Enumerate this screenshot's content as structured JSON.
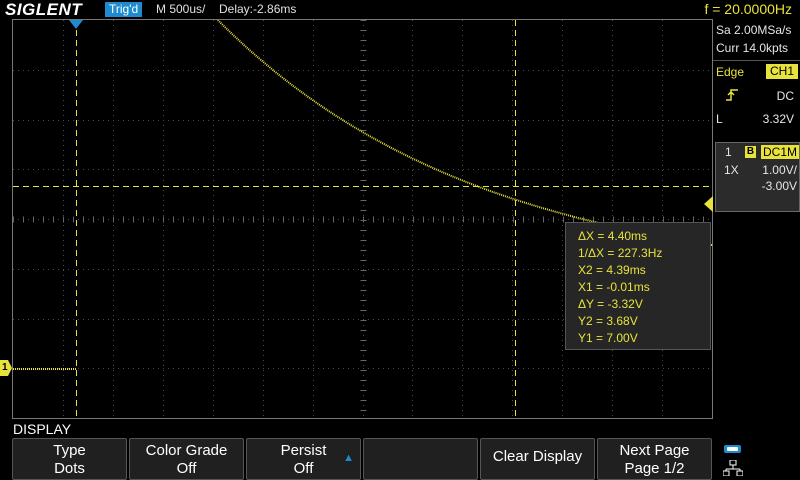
{
  "topbar": {
    "brand": "SIGLENT",
    "trigger_status": "Trig'd",
    "timebase": "M 500us/",
    "delay": "Delay:-2.86ms",
    "frequency": "f = 20.0000Hz"
  },
  "acquisition": {
    "sample_rate": "Sa 2.00MSa/s",
    "memory_depth": "Curr 14.0kpts"
  },
  "trigger": {
    "type": "Edge",
    "source": "CH1",
    "coupling": "DC",
    "level_label": "L",
    "level": "3.32V"
  },
  "channel": {
    "number": "1",
    "bandwidth_icon": "B",
    "coupling": "DC1M",
    "probe": "1X",
    "scale": "1.00V/",
    "offset": "-3.00V"
  },
  "marker": {
    "channel_label": "1"
  },
  "measurements": [
    {
      "label": "ΔX = 4.40ms"
    },
    {
      "label": "1/ΔX = 227.3Hz"
    },
    {
      "label": "X2 = 4.39ms"
    },
    {
      "label": "X1 = -0.01ms"
    },
    {
      "label": "ΔY = -3.32V"
    },
    {
      "label": "Y2 = 3.68V"
    },
    {
      "label": "Y1 = 7.00V"
    }
  ],
  "menu": {
    "title": "DISPLAY",
    "softkeys": [
      {
        "line1": "Type",
        "line2": "Dots"
      },
      {
        "line1": "Color Grade",
        "line2": "Off"
      },
      {
        "line1": "Persist",
        "line2": "Off"
      },
      {
        "line1": "",
        "line2": ""
      },
      {
        "line1": "Clear Display",
        "line2": ""
      },
      {
        "line1": "Next Page",
        "line2": "Page 1/2"
      }
    ]
  },
  "colors": {
    "trace": "#e8e33c",
    "accent": "#1e8bd0",
    "grid": "#4a4a4a"
  },
  "icons": [
    "trigger-position-icon",
    "rising-edge-icon",
    "channel-1-marker-icon",
    "trigger-level-marker-icon",
    "usb-icon",
    "network-icon"
  ]
}
